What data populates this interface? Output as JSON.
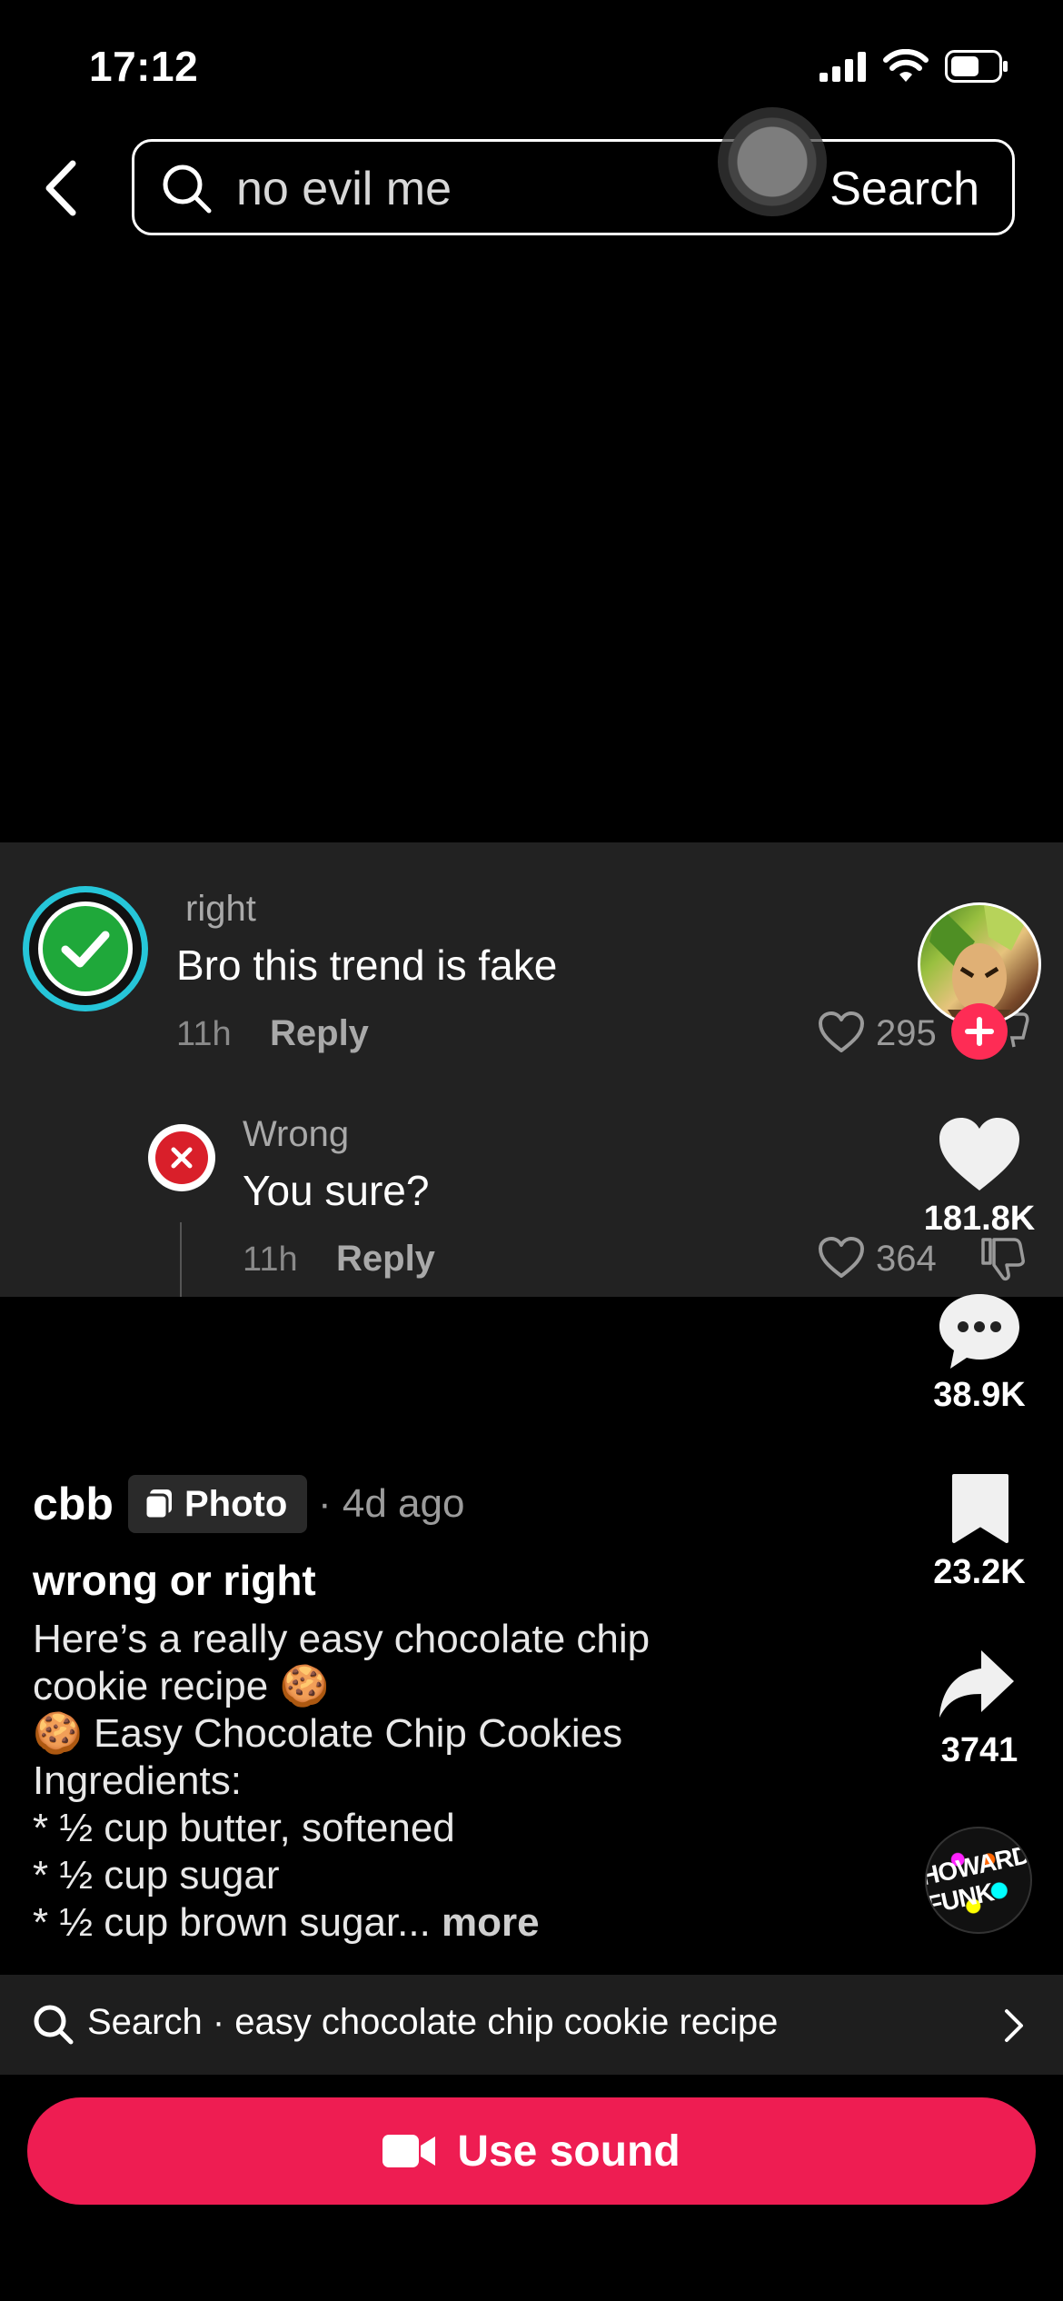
{
  "status_bar": {
    "time": "17:12"
  },
  "search": {
    "query": "no evil me",
    "button_label": "Search"
  },
  "comments": {
    "top": {
      "user": "right",
      "text": "Bro this trend is fake",
      "time": "11h",
      "reply_label": "Reply",
      "likes": "295"
    },
    "reply": {
      "user": "Wrong",
      "text": "You sure?",
      "time": "11h",
      "reply_label": "Reply",
      "likes": "364"
    }
  },
  "actions": {
    "likes": "181.8K",
    "comments": "38.9K",
    "bookmarks": "23.2K",
    "shares": "3741"
  },
  "post": {
    "author": "cbb",
    "badge": "Photo",
    "posted": "· 4d ago",
    "title": "wrong or right",
    "description": "Here’s a really easy chocolate chip\ncookie recipe 🍪\n🍪 Easy Chocolate Chip Cookies\nIngredients:\n* ½ cup butter, softened\n* ½ cup sugar\n* ½ cup brown sugar...",
    "more_label": "more"
  },
  "music_disc_text": "HOWARD FUNK",
  "suggestion": {
    "text": "Search · easy chocolate chip cookie recipe"
  },
  "use_sound": {
    "label": "Use sound"
  },
  "colors": {
    "accent": "#fe2c55",
    "button": "#ee1d52",
    "check_ring": "#26c6d9",
    "check_fill": "#1fa83a",
    "x_fill": "#d91f2a"
  }
}
